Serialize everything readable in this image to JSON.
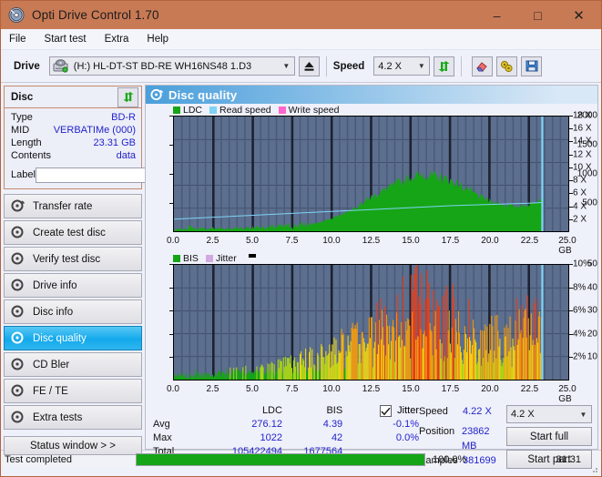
{
  "window": {
    "title": "Opti Drive Control 1.70",
    "icon": "disc-icon",
    "minimize": "–",
    "maximize": "□",
    "close": "✕",
    "titlebar_color": "#c87a55"
  },
  "menu": [
    {
      "label": "File"
    },
    {
      "label": "Start test"
    },
    {
      "label": "Extra"
    },
    {
      "label": "Help"
    }
  ],
  "toolbar": {
    "drive_label": "Drive",
    "drive_value": "(H:)  HL-DT-ST BD-RE  WH16NS48 1.D3",
    "eject_icon": "eject-icon",
    "speed_label": "Speed",
    "speed_value": "4.2 X",
    "refresh_icon": "refresh-icon",
    "eraser_icon": "eraser-icon",
    "tools_icon": "tools-icon",
    "save_icon": "save-icon"
  },
  "sidebar": {
    "disc": {
      "header": "Disc",
      "refresh_icon": "refresh-disc-icon",
      "rows": [
        {
          "key": "Type",
          "value": "BD-R"
        },
        {
          "key": "MID",
          "value": "VERBATIMe (000)"
        },
        {
          "key": "Length",
          "value": "23.31 GB"
        },
        {
          "key": "Contents",
          "value": "data"
        }
      ],
      "label_key": "Label",
      "label_value": "",
      "label_placeholder": "",
      "disc_button_icon": "cd-icon"
    },
    "nav": [
      {
        "label": "Transfer rate",
        "icon": "disc-test-icon",
        "active": false
      },
      {
        "label": "Create test disc",
        "icon": "disc-test-icon",
        "active": false
      },
      {
        "label": "Verify test disc",
        "icon": "disc-test-icon",
        "active": false
      },
      {
        "label": "Drive info",
        "icon": "disc-test-icon",
        "active": false
      },
      {
        "label": "Disc info",
        "icon": "disc-test-icon",
        "active": false
      },
      {
        "label": "Disc quality",
        "icon": "disc-test-icon",
        "active": true
      },
      {
        "label": "CD Bler",
        "icon": "disc-test-icon",
        "active": false
      },
      {
        "label": "FE / TE",
        "icon": "disc-test-icon",
        "active": false
      },
      {
        "label": "Extra tests",
        "icon": "disc-test-icon",
        "active": false
      }
    ],
    "status_window_button": "Status window > >"
  },
  "panel": {
    "title": "Disc quality",
    "icon": "disc-quality-icon"
  },
  "chart_data": [
    {
      "type": "area",
      "title": "LDC / Read speed",
      "xlabel": "GB",
      "ylabel": "LDC",
      "xlim": [
        0,
        25
      ],
      "xticks": [
        "0.0",
        "2.5",
        "5.0",
        "7.5",
        "10.0",
        "12.5",
        "15.0",
        "17.5",
        "20.0",
        "22.5",
        "25.0 GB"
      ],
      "ylim": [
        0,
        2000
      ],
      "yticks": [
        "2000",
        "1500",
        "1000",
        "500"
      ],
      "y2lim": [
        0,
        18
      ],
      "y2ticks": [
        "18 X",
        "16 X",
        "14 X",
        "12 X",
        "10 X",
        "8 X",
        "6 X",
        "4 X",
        "2 X"
      ],
      "legend": [
        {
          "label": "LDC",
          "color": "#16a516"
        },
        {
          "label": "Read speed",
          "color": "#7fd3f5"
        },
        {
          "label": "Write speed",
          "color": "#ff66cc"
        }
      ],
      "legend_position": "top-left",
      "grid": true,
      "series": [
        {
          "name": "LDC",
          "color": "#16a516",
          "x": [
            0.0,
            0.5,
            1.0,
            1.5,
            2.0,
            2.5,
            3.0,
            3.5,
            4.0,
            4.5,
            5.0,
            5.5,
            6.0,
            6.5,
            7.0,
            7.5,
            8.0,
            8.5,
            9.0,
            9.5,
            10.0,
            10.5,
            11.0,
            11.5,
            12.0,
            12.5,
            13.0,
            13.5,
            14.0,
            14.5,
            15.0,
            15.5,
            16.0,
            16.5,
            17.0,
            17.5,
            18.0,
            18.5,
            19.0,
            19.5,
            20.0,
            20.5,
            21.0,
            21.5,
            22.0,
            22.5,
            23.0,
            23.3
          ],
          "values": [
            20,
            30,
            60,
            40,
            35,
            45,
            40,
            40,
            45,
            50,
            55,
            60,
            60,
            65,
            75,
            80,
            90,
            110,
            140,
            180,
            230,
            290,
            350,
            430,
            520,
            600,
            680,
            760,
            830,
            900,
            960,
            990,
            1000,
            980,
            950,
            900,
            840,
            760,
            680,
            600,
            540,
            500,
            470,
            450,
            450,
            470,
            560,
            600
          ]
        },
        {
          "name": "Read speed",
          "color": "#7fd3f5",
          "x": [
            0.0,
            2.5,
            5.0,
            7.5,
            10.0,
            12.5,
            15.0,
            17.5,
            20.0,
            22.5,
            23.3
          ],
          "values": [
            1.9,
            2.2,
            2.5,
            2.8,
            3.1,
            3.4,
            3.7,
            4.0,
            4.2,
            4.4,
            4.5
          ]
        }
      ]
    },
    {
      "type": "bar",
      "title": "BIS / Jitter",
      "xlabel": "GB",
      "ylabel": "BIS",
      "xlim": [
        0,
        25
      ],
      "xticks": [
        "0.0",
        "2.5",
        "5.0",
        "7.5",
        "10.0",
        "12.5",
        "15.0",
        "17.5",
        "20.0",
        "22.5",
        "25.0 GB"
      ],
      "ylim": [
        0,
        50
      ],
      "yticks": [
        "50",
        "40",
        "30",
        "20",
        "10"
      ],
      "y2lim": [
        0,
        10
      ],
      "y2ticks": [
        "10%",
        "8%",
        "6%",
        "4%",
        "2%"
      ],
      "legend": [
        {
          "label": "BIS",
          "color": "#16a516"
        },
        {
          "label": "Jitter",
          "color": "#d2a8e0"
        }
      ],
      "legend_position": "top-left",
      "grid": true,
      "series": [
        {
          "name": "BIS",
          "color_scale": [
            "#16a516",
            "#a8d41a",
            "#e8d21a",
            "#f09a12",
            "#ee3b14"
          ],
          "x": [
            0.2,
            0.6,
            1.0,
            1.4,
            1.8,
            2.2,
            2.6,
            3.0,
            3.4,
            3.8,
            4.2,
            4.6,
            5.0,
            5.4,
            5.8,
            6.2,
            6.6,
            7.0,
            7.4,
            7.8,
            8.2,
            8.6,
            9.0,
            9.4,
            9.8,
            10.2,
            10.6,
            11.0,
            11.4,
            11.8,
            12.2,
            12.6,
            13.0,
            13.4,
            13.8,
            14.2,
            14.6,
            15.0,
            15.4,
            15.8,
            16.2,
            16.6,
            17.0,
            17.4,
            17.8,
            18.2,
            18.6,
            19.0,
            19.4,
            19.8,
            20.2,
            20.6,
            21.0,
            21.4,
            21.8,
            22.2,
            22.6,
            23.0,
            23.2
          ],
          "values": [
            2,
            3,
            2,
            4,
            3,
            3,
            4,
            3,
            4,
            5,
            4,
            5,
            6,
            5,
            6,
            7,
            7,
            8,
            9,
            8,
            11,
            12,
            10,
            14,
            13,
            16,
            18,
            15,
            22,
            20,
            26,
            24,
            30,
            28,
            36,
            32,
            41,
            38,
            44,
            36,
            40,
            34,
            38,
            30,
            34,
            26,
            30,
            24,
            22,
            20,
            26,
            22,
            28,
            24,
            30,
            26,
            32,
            42,
            30
          ]
        }
      ]
    }
  ],
  "stats": {
    "headers": [
      "",
      "LDC",
      "BIS",
      "Jitter"
    ],
    "jitter_checked": true,
    "jitter_label": "Jitter",
    "rows": [
      {
        "label": "Avg",
        "ldc": "276.12",
        "bis": "4.39",
        "jitter": "-0.1%"
      },
      {
        "label": "Max",
        "ldc": "1022",
        "bis": "42",
        "jitter": "0.0%"
      },
      {
        "label": "Total",
        "ldc": "105422494",
        "bis": "1677564",
        "jitter": ""
      }
    ]
  },
  "controls": {
    "speed_label": "Speed",
    "speed_value": "4.22 X",
    "speed_select": "4.2 X",
    "position_label": "Position",
    "position_value": "23862 MB",
    "samples_label": "Samples",
    "samples_value": "381699",
    "start_full": "Start full",
    "start_part": "Start part"
  },
  "statusbar": {
    "text": "Test completed",
    "progress_percent": "100.0%",
    "progress_value": 100,
    "elapsed": "31:31",
    "progress_color": "#16a516"
  }
}
